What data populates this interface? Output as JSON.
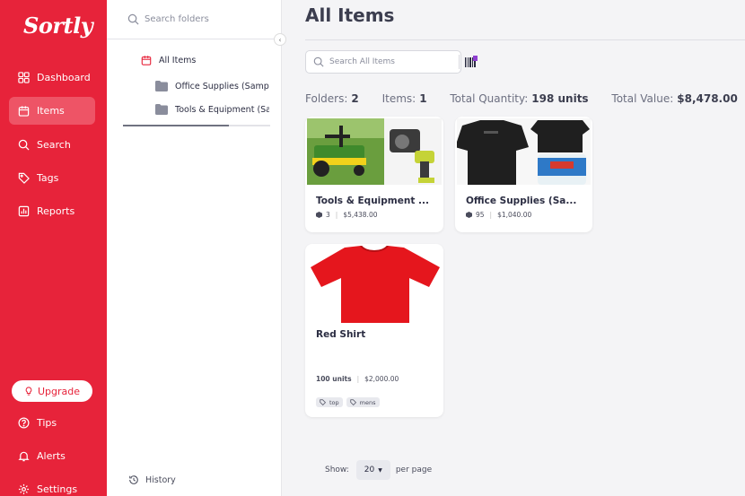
{
  "brand": {
    "logo_text": "Sortly",
    "color": "#e7233a"
  },
  "sidebar": {
    "items": [
      {
        "label": "Dashboard",
        "icon": "dashboard-icon"
      },
      {
        "label": "Items",
        "icon": "items-icon",
        "active": true
      },
      {
        "label": "Search",
        "icon": "search-icon"
      },
      {
        "label": "Tags",
        "icon": "tag-icon"
      },
      {
        "label": "Reports",
        "icon": "reports-icon"
      }
    ],
    "upgrade_label": "Upgrade",
    "bottom": [
      {
        "label": "Tips",
        "icon": "help-icon"
      },
      {
        "label": "Alerts",
        "icon": "bell-icon"
      },
      {
        "label": "Settings",
        "icon": "gear-icon"
      }
    ]
  },
  "folder_panel": {
    "search_placeholder": "Search folders",
    "root": "All Items",
    "children": [
      "Office Supplies (Sample)",
      "Tools & Equipment (Sample)"
    ],
    "history_label": "History"
  },
  "main": {
    "title": "All Items",
    "search_placeholder": "Search All Items",
    "stats": {
      "folders_label": "Folders:",
      "folders": "2",
      "items_label": "Items:",
      "items": "1",
      "quantity_label": "Total Quantity:",
      "quantity": "198 units",
      "value_label": "Total Value:",
      "value": "$8,478.00"
    },
    "cards": [
      {
        "name": "Tools & Equipment ...",
        "count": "3",
        "value": "$5,438.00"
      },
      {
        "name": "Office Supplies (Sa...",
        "count": "95",
        "value": "$1,040.00"
      },
      {
        "name": "Red Shirt",
        "units": "100 units",
        "value": "$2,000.00",
        "tags": [
          "top",
          "mens"
        ]
      }
    ],
    "pager": {
      "show_label": "Show:",
      "per_page_value": "20",
      "per_page_label": "per page"
    }
  }
}
